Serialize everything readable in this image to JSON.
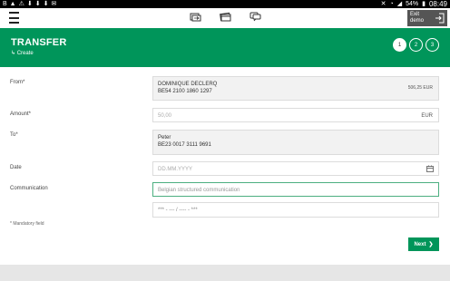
{
  "status_bar": {
    "left_icons": [
      "B",
      "▲",
      "⚠",
      "⬇",
      "⬇",
      "⬇",
      "✉"
    ],
    "battery": "54%",
    "time": "08:49"
  },
  "topbar": {
    "menu_icon": "hamburger-icon",
    "icons": [
      "transfer-icon",
      "card-icon",
      "chat-icon"
    ],
    "exit_demo_label": "Exit demo"
  },
  "header": {
    "title": "TRANSFER",
    "subtitle": "↳ Create",
    "steps": [
      "1",
      "2",
      "3"
    ],
    "active_step": 1,
    "color": "#00955a"
  },
  "form": {
    "from": {
      "label": "From*",
      "name": "DOMINIQUE DECLERQ",
      "iban": "BE54 2100 1860 1297",
      "balance": "506,25 EUR"
    },
    "amount": {
      "label": "Amount*",
      "placeholder": "50,00",
      "currency": "EUR"
    },
    "to": {
      "label": "To*",
      "name": "Peter",
      "iban": "BE23 0017 3111 9691"
    },
    "date": {
      "label": "Date",
      "placeholder": "DD.MM.YYYY"
    },
    "communication": {
      "label": "Communication",
      "placeholder": "Belgian structured communication",
      "structured_placeholder": "*** - --- / ---- - ***"
    },
    "mandatory_note": "* Mandatory field",
    "next_label": "Next"
  }
}
